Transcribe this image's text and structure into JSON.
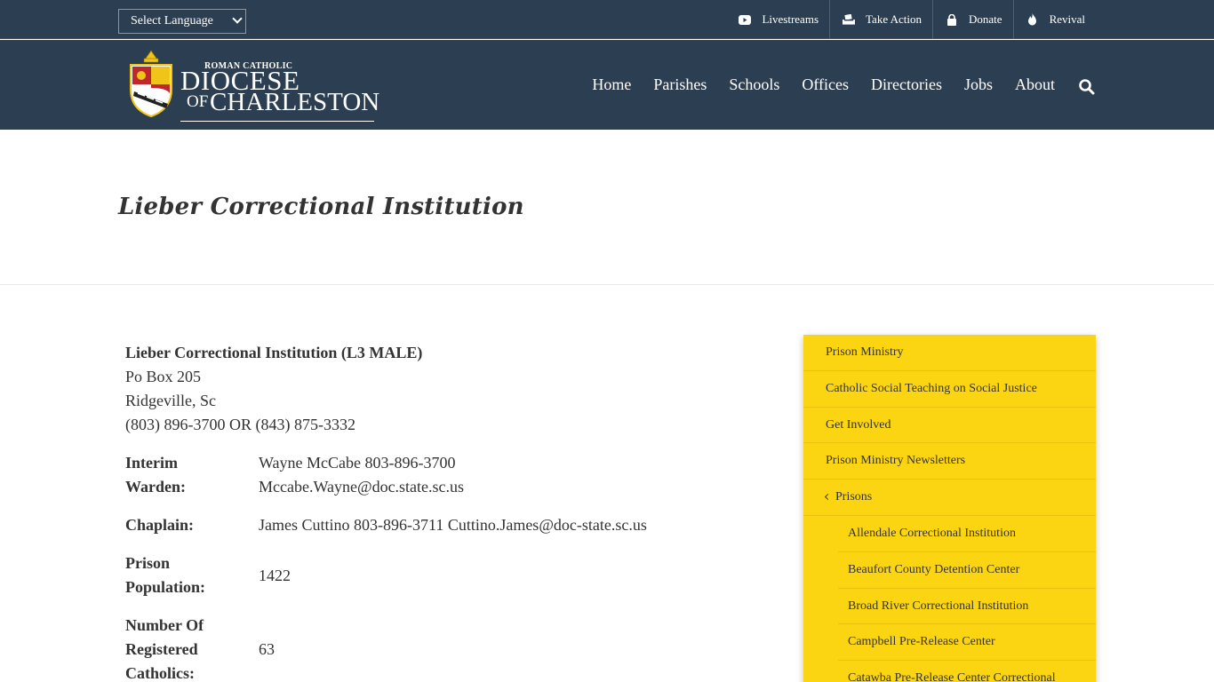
{
  "topbar": {
    "language_select": "Select Language",
    "links": [
      {
        "label": "Livestreams",
        "icon": "youtube-icon"
      },
      {
        "label": "Take Action",
        "icon": "ballot-box-icon"
      },
      {
        "label": "Donate",
        "icon": "lock-icon"
      },
      {
        "label": "Revival",
        "icon": "flame-icon"
      }
    ]
  },
  "logo": {
    "line1": "ROMAN CATHOLIC",
    "line2": "DIOCESE",
    "line3a": "OF",
    "line3b": "CHARLESTON"
  },
  "nav": {
    "items": [
      "Home",
      "Parishes",
      "Schools",
      "Offices",
      "Directories",
      "Jobs",
      "About"
    ]
  },
  "page": {
    "title": "Lieber Correctional Institution"
  },
  "facility": {
    "name": "Lieber Correctional Institution (L3 MALE)",
    "address1": "Po Box 205",
    "address2": "Ridgeville, Sc",
    "phone": "(803) 896-3700 OR (843) 875-3332",
    "rows": [
      {
        "label1": "Interim",
        "label2": "Warden:",
        "value1": "Wayne McCabe 803-896-3700",
        "value2": "Mccabe.Wayne@doc.state.sc.us"
      },
      {
        "label": "Chaplain:",
        "value": "James Cuttino 803-896-3711 Cuttino.James@doc-state.sc.us"
      },
      {
        "label1": "Prison",
        "label2": "Population:",
        "value": "1422"
      },
      {
        "label1": "Number Of",
        "label2": "Registered",
        "label3": "Catholics:",
        "value": "63"
      }
    ]
  },
  "sidebar": {
    "items": [
      "Prison Ministry",
      "Catholic Social Teaching on Social Justice",
      "Get Involved",
      "Prison Ministry Newsletters",
      "Prisons"
    ],
    "subitems": [
      "Allendale Correctional Institution",
      "Beaufort County Detention Center",
      "Broad River Correctional Institution",
      "Campbell Pre-Release Center",
      "Catawba Pre-Release Center Correctional"
    ]
  },
  "colors": {
    "navy": "#2c3e51",
    "sidebar_yellow": "#fcd512",
    "crest_gold": "#f0c419",
    "crest_red": "#c0272d"
  }
}
